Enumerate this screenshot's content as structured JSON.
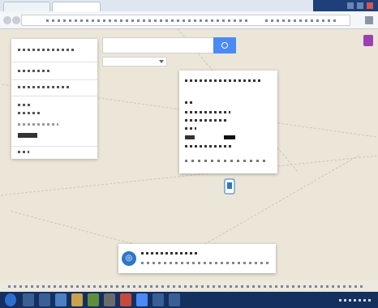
{
  "window": {
    "title": ""
  },
  "tabs": [
    {
      "label": ""
    },
    {
      "label": ""
    }
  ],
  "address_bar": {
    "url": ""
  },
  "search": {
    "query": "",
    "placeholder": ""
  },
  "filter": {
    "label": ""
  },
  "panel": {
    "title": "",
    "items": [
      {
        "label": ""
      },
      {
        "label": ""
      },
      {
        "label": ""
      },
      {
        "label": ""
      },
      {
        "label": ""
      }
    ]
  },
  "info_card": {
    "title": "",
    "lines": [
      "",
      "",
      "",
      "",
      "",
      ""
    ]
  },
  "bottom_card": {
    "title": "",
    "subtitle": ""
  },
  "colors": {
    "accent": "#4a8af4",
    "taskbar": "#14305f",
    "map_bg": "#ebe6d8"
  }
}
